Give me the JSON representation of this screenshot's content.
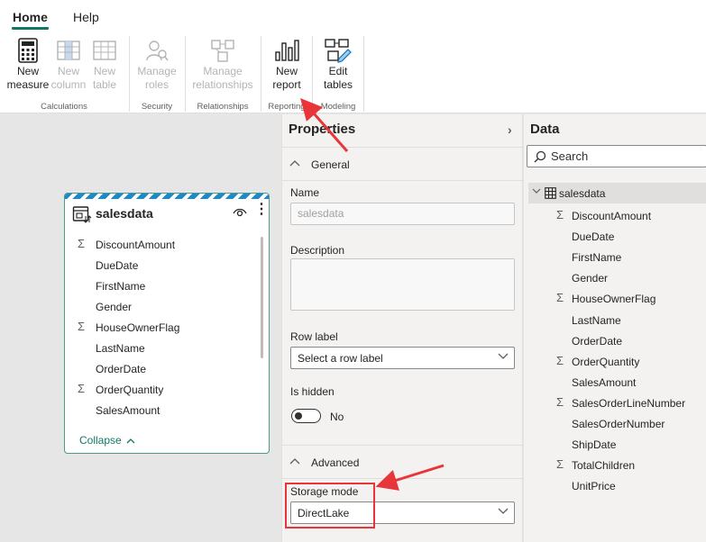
{
  "ribbon": {
    "tabs": [
      {
        "label": "Home",
        "active": true
      },
      {
        "label": "Help",
        "active": false
      }
    ],
    "buttons": [
      {
        "label_line1": "New",
        "label_line2": "measure",
        "icon": "calculator-icon",
        "enabled": true
      },
      {
        "label_line1": "New",
        "label_line2": "column",
        "icon": "column-grid-icon",
        "enabled": false
      },
      {
        "label_line1": "New",
        "label_line2": "table",
        "icon": "table-grid-icon",
        "enabled": false
      },
      {
        "label_line1": "Manage",
        "label_line2": "roles",
        "icon": "person-search-icon",
        "enabled": false
      },
      {
        "label_line1": "Manage",
        "label_line2": "relationships",
        "icon": "relationships-icon",
        "enabled": false
      },
      {
        "label_line1": "New",
        "label_line2": "report",
        "icon": "bar-chart-icon",
        "enabled": true
      },
      {
        "label_line1": "Edit",
        "label_line2": "tables",
        "icon": "edit-tables-icon",
        "enabled": true
      }
    ],
    "groups": [
      "Calculations",
      "Security",
      "Relationships",
      "Reporting",
      "Modeling"
    ]
  },
  "card": {
    "title": "salesdata",
    "fields": [
      {
        "name": "DiscountAmount",
        "sigma": true
      },
      {
        "name": "DueDate",
        "sigma": false
      },
      {
        "name": "FirstName",
        "sigma": false
      },
      {
        "name": "Gender",
        "sigma": false
      },
      {
        "name": "HouseOwnerFlag",
        "sigma": true
      },
      {
        "name": "LastName",
        "sigma": false
      },
      {
        "name": "OrderDate",
        "sigma": false
      },
      {
        "name": "OrderQuantity",
        "sigma": true
      },
      {
        "name": "SalesAmount",
        "sigma": false
      }
    ],
    "collapse_label": "Collapse",
    "sigma_glyph": "Σ"
  },
  "properties": {
    "title": "Properties",
    "general_label": "General",
    "name_label": "Name",
    "name_value": "salesdata",
    "description_label": "Description",
    "row_label_label": "Row label",
    "row_label_value": "Select a row label",
    "is_hidden_label": "Is hidden",
    "is_hidden_value": "No",
    "advanced_label": "Advanced",
    "storage_mode_label": "Storage mode",
    "storage_mode_value": "DirectLake"
  },
  "data_pane": {
    "title": "Data",
    "search_placeholder": "Search",
    "table_name": "salesdata",
    "fields": [
      {
        "name": "DiscountAmount",
        "sigma": true
      },
      {
        "name": "DueDate",
        "sigma": false
      },
      {
        "name": "FirstName",
        "sigma": false
      },
      {
        "name": "Gender",
        "sigma": false
      },
      {
        "name": "HouseOwnerFlag",
        "sigma": true
      },
      {
        "name": "LastName",
        "sigma": false
      },
      {
        "name": "OrderDate",
        "sigma": false
      },
      {
        "name": "OrderQuantity",
        "sigma": true
      },
      {
        "name": "SalesAmount",
        "sigma": false
      },
      {
        "name": "SalesOrderLineNumber",
        "sigma": true
      },
      {
        "name": "SalesOrderNumber",
        "sigma": false
      },
      {
        "name": "ShipDate",
        "sigma": false
      },
      {
        "name": "TotalChildren",
        "sigma": true
      },
      {
        "name": "UnitPrice",
        "sigma": false
      }
    ]
  },
  "colors": {
    "accent": "#117865",
    "annotation_red": "#e8353a",
    "card_stripe": "#1e88c9"
  }
}
